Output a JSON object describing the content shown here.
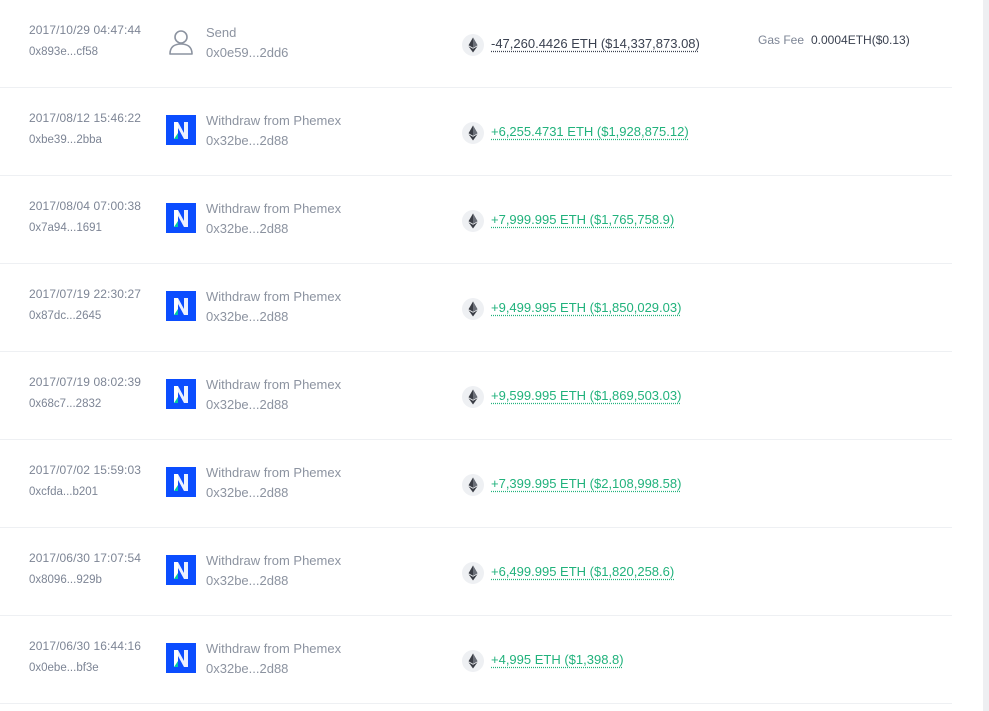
{
  "gas_fee_label": "Gas Fee",
  "transactions": [
    {
      "timestamp": "2017/10/29 04:47:44",
      "hash": "0x893e...cf58",
      "type": "send",
      "counterparty_name": "Send",
      "counterparty_address": "0x0e59...2dd6",
      "amount": "-47,260.4426 ETH ($14,337,873.08)",
      "direction": "out",
      "gas_fee": "0.0004ETH($0.13)"
    },
    {
      "timestamp": "2017/08/12 15:46:22",
      "hash": "0xbe39...2bba",
      "type": "exchange",
      "counterparty_name": "Withdraw from Phemex",
      "counterparty_address": "0x32be...2d88",
      "amount": "+6,255.4731 ETH ($1,928,875.12)",
      "direction": "in"
    },
    {
      "timestamp": "2017/08/04 07:00:38",
      "hash": "0x7a94...1691",
      "type": "exchange",
      "counterparty_name": "Withdraw from Phemex",
      "counterparty_address": "0x32be...2d88",
      "amount": "+7,999.995 ETH ($1,765,758.9)",
      "direction": "in"
    },
    {
      "timestamp": "2017/07/19 22:30:27",
      "hash": "0x87dc...2645",
      "type": "exchange",
      "counterparty_name": "Withdraw from Phemex",
      "counterparty_address": "0x32be...2d88",
      "amount": "+9,499.995 ETH ($1,850,029.03)",
      "direction": "in"
    },
    {
      "timestamp": "2017/07/19 08:02:39",
      "hash": "0x68c7...2832",
      "type": "exchange",
      "counterparty_name": "Withdraw from Phemex",
      "counterparty_address": "0x32be...2d88",
      "amount": "+9,599.995 ETH ($1,869,503.03)",
      "direction": "in"
    },
    {
      "timestamp": "2017/07/02 15:59:03",
      "hash": "0xcfda...b201",
      "type": "exchange",
      "counterparty_name": "Withdraw from Phemex",
      "counterparty_address": "0x32be...2d88",
      "amount": "+7,399.995 ETH ($2,108,998.58)",
      "direction": "in"
    },
    {
      "timestamp": "2017/06/30 17:07:54",
      "hash": "0x8096...929b",
      "type": "exchange",
      "counterparty_name": "Withdraw from Phemex",
      "counterparty_address": "0x32be...2d88",
      "amount": "+6,499.995 ETH ($1,820,258.6)",
      "direction": "in"
    },
    {
      "timestamp": "2017/06/30 16:44:16",
      "hash": "0x0ebe...bf3e",
      "type": "exchange",
      "counterparty_name": "Withdraw from Phemex",
      "counterparty_address": "0x32be...2d88",
      "amount": "+4,995 ETH ($1,398.8)",
      "direction": "in"
    }
  ],
  "icons": {
    "send": "user-outline-icon",
    "exchange": "phemex-logo-icon",
    "coin": "eth-icon"
  },
  "colors": {
    "positive": "#21b27c",
    "negative": "#3a4150",
    "phemex_blue": "#0b4dff"
  }
}
